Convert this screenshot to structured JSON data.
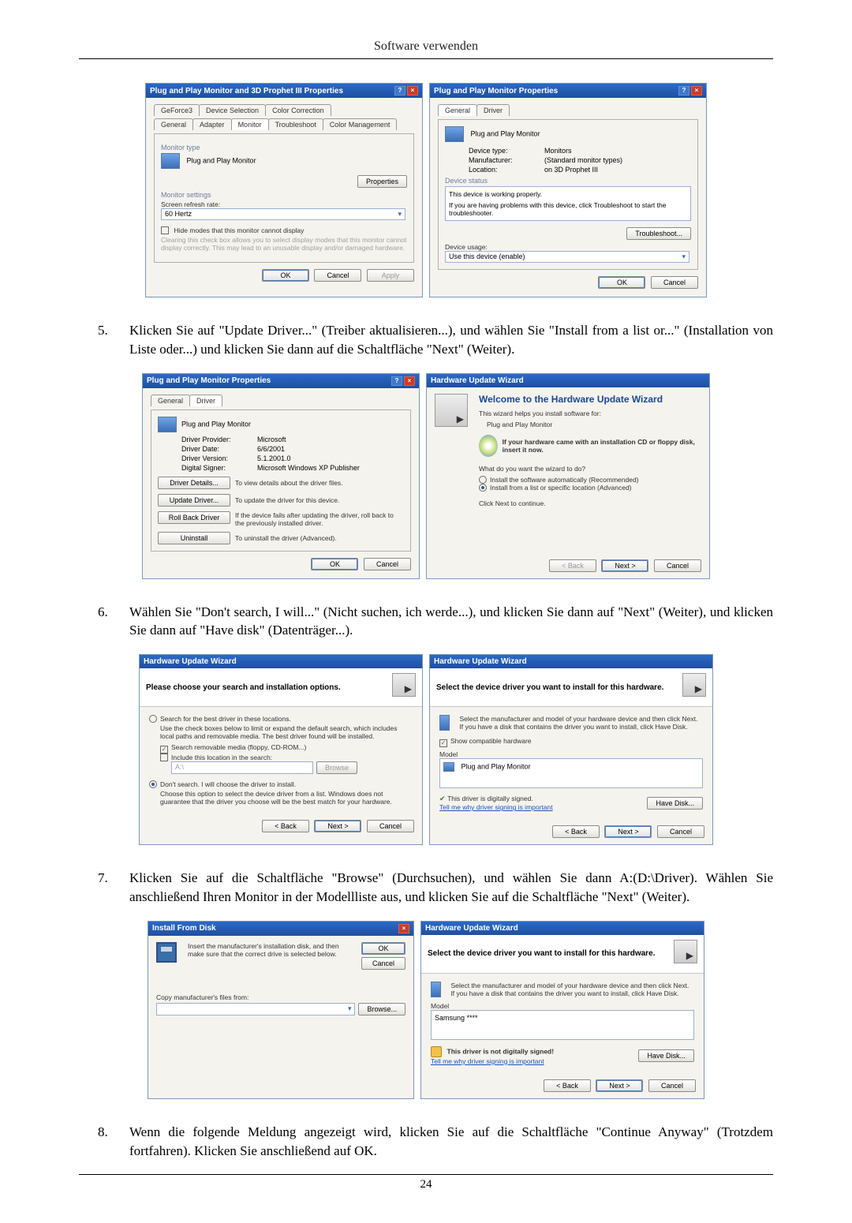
{
  "header": "Software verwenden",
  "page_number": "24",
  "shot1": {
    "left": {
      "title": "Plug and Play Monitor and 3D Prophet III Properties",
      "tabs_row1": [
        "GeForce3",
        "Device Selection",
        "Color Correction"
      ],
      "tabs_row2": [
        "General",
        "Adapter",
        "Monitor",
        "Troubleshoot",
        "Color Management"
      ],
      "monitor_type": "Monitor type",
      "monitor_name": "Plug and Play Monitor",
      "properties_btn": "Properties",
      "monitor_settings": "Monitor settings",
      "refresh_label": "Screen refresh rate:",
      "refresh_value": "60 Hertz",
      "hide_modes": "Hide modes that this monitor cannot display",
      "hide_modes_desc": "Clearing this check box allows you to select display modes that this monitor cannot display correctly. This may lead to an unusable display and/or damaged hardware.",
      "ok": "OK",
      "cancel": "Cancel",
      "apply": "Apply"
    },
    "right": {
      "title": "Plug and Play Monitor Properties",
      "tabs": [
        "General",
        "Driver"
      ],
      "name": "Plug and Play Monitor",
      "devtype_k": "Device type:",
      "devtype_v": "Monitors",
      "manu_k": "Manufacturer:",
      "manu_v": "(Standard monitor types)",
      "loc_k": "Location:",
      "loc_v": "on 3D Prophet III",
      "device_status": "Device status",
      "status_text": "This device is working properly.",
      "status_help": "If you are having problems with this device, click Troubleshoot to start the troubleshooter.",
      "troubleshoot_btn": "Troubleshoot...",
      "usage_label": "Device usage:",
      "usage_value": "Use this device (enable)",
      "ok": "OK",
      "cancel": "Cancel"
    }
  },
  "step5": {
    "num": "5.",
    "txt": "Klicken Sie auf \"Update Driver...\" (Treiber aktualisieren...), und wählen Sie \"Install from a list or...\" (Installation von Liste oder...) und klicken Sie dann auf die Schaltfläche \"Next\" (Weiter)."
  },
  "shot2": {
    "left": {
      "title": "Plug and Play Monitor Properties",
      "tabs": [
        "General",
        "Driver"
      ],
      "name": "Plug and Play Monitor",
      "provider_k": "Driver Provider:",
      "provider_v": "Microsoft",
      "date_k": "Driver Date:",
      "date_v": "6/6/2001",
      "version_k": "Driver Version:",
      "version_v": "5.1.2001.0",
      "signer_k": "Digital Signer:",
      "signer_v": "Microsoft Windows XP Publisher",
      "driver_details": "Driver Details...",
      "driver_details_desc": "To view details about the driver files.",
      "update_driver": "Update Driver...",
      "update_driver_desc": "To update the driver for this device.",
      "rollback": "Roll Back Driver",
      "rollback_desc": "If the device fails after updating the driver, roll back to the previously installed driver.",
      "uninstall": "Uninstall",
      "uninstall_desc": "To uninstall the driver (Advanced).",
      "ok": "OK",
      "cancel": "Cancel"
    },
    "right": {
      "title": "Hardware Update Wizard",
      "h": "Welcome to the Hardware Update Wizard",
      "p1": "This wizard helps you install software for:",
      "p2": "Plug and Play Monitor",
      "cd_msg": "If your hardware came with an installation CD or floppy disk, insert it now.",
      "q": "What do you want the wizard to do?",
      "opt1": "Install the software automatically (Recommended)",
      "opt2": "Install from a list or specific location (Advanced)",
      "cont": "Click Next to continue.",
      "back": "< Back",
      "next": "Next >",
      "cancel": "Cancel"
    }
  },
  "step6": {
    "num": "6.",
    "txt": "Wählen Sie \"Don't search, I will...\" (Nicht suchen, ich werde...), und klicken Sie dann auf \"Next\" (Weiter), und klicken Sie dann auf \"Have disk\" (Datenträger...)."
  },
  "shot3": {
    "left": {
      "title": "Hardware Update Wizard",
      "head": "Please choose your search and installation options.",
      "opt1": "Search for the best driver in these locations.",
      "opt1_desc": "Use the check boxes below to limit or expand the default search, which includes local paths and removable media. The best driver found will be installed.",
      "chk1": "Search removable media (floppy, CD-ROM...)",
      "chk2": "Include this location in the search:",
      "path": "A:\\",
      "browse": "Browse",
      "opt2": "Don't search. I will choose the driver to install.",
      "opt2_desc": "Choose this option to select the device driver from a list. Windows does not guarantee that the driver you choose will be the best match for your hardware.",
      "back": "< Back",
      "next": "Next >",
      "cancel": "Cancel"
    },
    "right": {
      "title": "Hardware Update Wizard",
      "head": "Select the device driver you want to install for this hardware.",
      "desc": "Select the manufacturer and model of your hardware device and then click Next. If you have a disk that contains the driver you want to install, click Have Disk.",
      "compat_chk": "Show compatible hardware",
      "model_label": "Model",
      "model_item": "Plug and Play Monitor",
      "sign_msg": "This driver is digitally signed.",
      "sign_link": "Tell me why driver signing is important",
      "have_disk": "Have Disk...",
      "back": "< Back",
      "next": "Next >",
      "cancel": "Cancel"
    }
  },
  "step7": {
    "num": "7.",
    "txt": "Klicken Sie auf die Schaltfläche \"Browse\" (Durchsuchen), und wählen Sie dann A:(D:\\Driver). Wählen Sie anschließend Ihren Monitor in der Modellliste aus, und klicken Sie auf die Schaltfläche \"Next\" (Weiter)."
  },
  "shot4": {
    "left": {
      "title": "Install From Disk",
      "msg": "Insert the manufacturer's installation disk, and then make sure that the correct drive is selected below.",
      "ok": "OK",
      "cancel": "Cancel",
      "copy_label": "Copy manufacturer's files from:",
      "path": " ",
      "browse": "Browse..."
    },
    "right": {
      "title": "Hardware Update Wizard",
      "head": "Select the device driver you want to install for this hardware.",
      "desc": "Select the manufacturer and model of your hardware device and then click Next. If you have a disk that contains the driver you want to install, click Have Disk.",
      "model_label": "Model",
      "model_item": "Samsung ****",
      "sign_msg": "This driver is not digitally signed!",
      "sign_link": "Tell me why driver signing is important",
      "have_disk": "Have Disk...",
      "back": "< Back",
      "next": "Next >",
      "cancel": "Cancel"
    }
  },
  "step8": {
    "num": "8.",
    "txt": "Wenn die folgende Meldung angezeigt wird, klicken Sie auf die Schaltfläche \"Continue Anyway\" (Trotzdem fortfahren). Klicken Sie anschließend auf OK."
  }
}
